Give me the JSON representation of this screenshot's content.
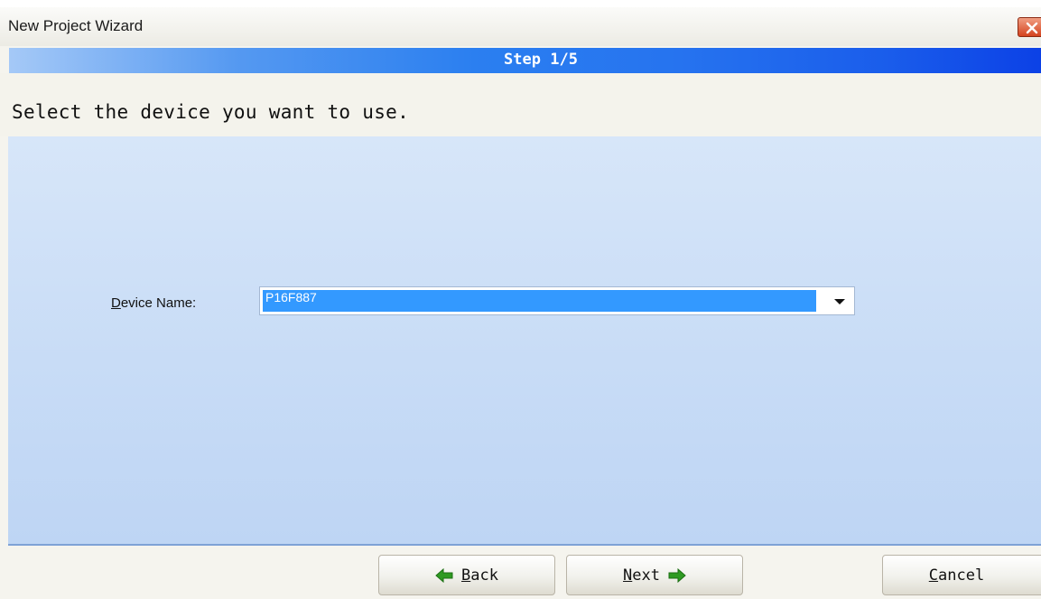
{
  "window": {
    "title": "New Project Wizard",
    "close_icon": "close-icon"
  },
  "wizard": {
    "step": "Step 1/5",
    "instruction": "Select the device you want to use."
  },
  "device": {
    "label_mnemonic": "D",
    "label_rest": "evice Name:",
    "selected_value": "P16F887",
    "dropdown_icon": "chevron-down-icon"
  },
  "buttons": {
    "back": {
      "mnemonic": "B",
      "rest": "ack",
      "icon": "arrow-left-icon"
    },
    "next": {
      "mnemonic": "N",
      "rest": "ext",
      "icon": "arrow-right-icon"
    },
    "cancel": {
      "mnemonic": "C",
      "rest": "ancel"
    }
  },
  "colors": {
    "arrow_green": "#2e9a22",
    "selection_blue": "#3399ff",
    "step_bar_blue": "#2673ef"
  }
}
